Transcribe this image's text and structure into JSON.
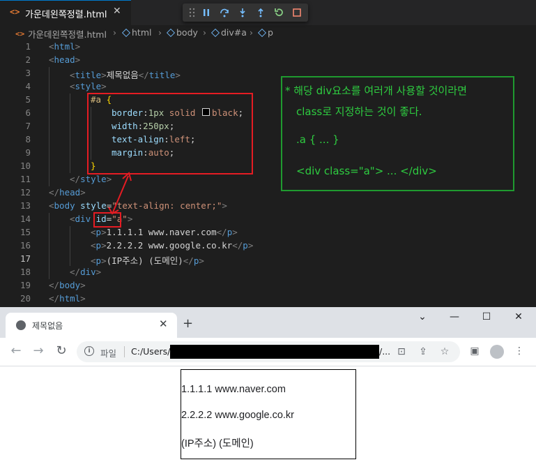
{
  "editor": {
    "tab": {
      "icon": "html-file-icon",
      "title": "가운데왼쪽정렬.html",
      "close": "✕"
    },
    "breadcrumbs": [
      "가운데왼쪽정렬.html",
      "html",
      "body",
      "div#a",
      "p"
    ],
    "lines": [
      {
        "n": "1",
        "text": "<html>"
      },
      {
        "n": "2",
        "text": "<head>"
      },
      {
        "n": "3",
        "text": "<title>제목없음</title>"
      },
      {
        "n": "4",
        "text": "<style>"
      },
      {
        "n": "5",
        "text": "#a {"
      },
      {
        "n": "6",
        "text": "border:1px solid black;"
      },
      {
        "n": "7",
        "text": "width:250px;"
      },
      {
        "n": "8",
        "text": "text-align:left;"
      },
      {
        "n": "9",
        "text": "margin:auto;"
      },
      {
        "n": "10",
        "text": "}"
      },
      {
        "n": "11",
        "text": "</style>"
      },
      {
        "n": "12",
        "text": "</head>"
      },
      {
        "n": "13",
        "text": "<body style=\"text-align: center;\">"
      },
      {
        "n": "14",
        "text": "<div id=\"a\">"
      },
      {
        "n": "15",
        "text": "<p>1.1.1.1 www.naver.com</p>"
      },
      {
        "n": "16",
        "text": "<p>2.2.2.2 www.google.co.kr</p>"
      },
      {
        "n": "17",
        "text": "<p>(IP주소) (도메인)</p>"
      },
      {
        "n": "18",
        "text": "</div>"
      },
      {
        "n": "19",
        "text": "</body>"
      },
      {
        "n": "20",
        "text": "</html>"
      }
    ],
    "active_line": "17",
    "annotation": {
      "line1": "* 해당 div요소를 여러개 사용할 것이라면",
      "line2": "class로 지정하는 것이 좋다.",
      "line3": ".a { ... }",
      "line4": "<div class=\"a\"> ... </div>"
    },
    "colors": {
      "background": "#1e1e1e",
      "tag": "#569cd6",
      "attr": "#9cdcfe",
      "string": "#ce9178",
      "highlight_red": "#e51c23",
      "note_green": "#2ecc40"
    }
  },
  "browser": {
    "tab_title": "제목없음",
    "new_tab": "+",
    "window_controls": [
      "⌄",
      "—",
      "☐",
      "✕"
    ],
    "address_label": "파일",
    "url_start": "C:/Users/",
    "url_end": "/...",
    "content": [
      "1.1.1.1 www.naver.com",
      "2.2.2.2 www.google.co.kr",
      "(IP주소) (도메인)"
    ]
  }
}
